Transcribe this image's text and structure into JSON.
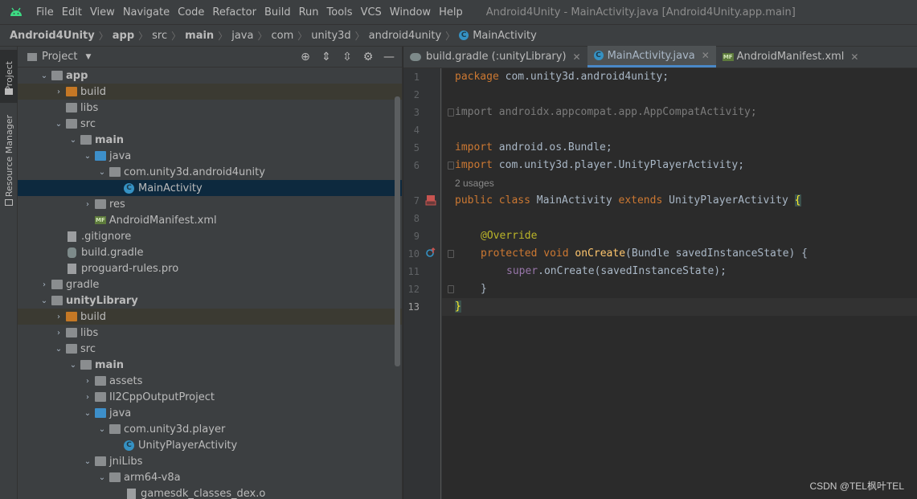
{
  "menubar": {
    "items": [
      "File",
      "Edit",
      "View",
      "Navigate",
      "Code",
      "Refactor",
      "Build",
      "Run",
      "Tools",
      "VCS",
      "Window",
      "Help"
    ],
    "title": "Android4Unity - MainActivity.java [Android4Unity.app.main]"
  },
  "breadcrumb": {
    "items": [
      "Android4Unity",
      "app",
      "src",
      "main",
      "java",
      "com",
      "unity3d",
      "android4unity",
      "MainActivity"
    ]
  },
  "toolstrip": {
    "project_tab": "Project",
    "resource_tab": "Resource Manager"
  },
  "project_panel": {
    "title": "Project",
    "tree": [
      {
        "label": "app",
        "bold": true
      },
      {
        "label": "build"
      },
      {
        "label": "libs"
      },
      {
        "label": "src"
      },
      {
        "label": "main",
        "bold": true
      },
      {
        "label": "java"
      },
      {
        "label": "com.unity3d.android4unity"
      },
      {
        "label": "MainActivity"
      },
      {
        "label": "res"
      },
      {
        "label": "AndroidManifest.xml"
      },
      {
        "label": ".gitignore"
      },
      {
        "label": "build.gradle"
      },
      {
        "label": "proguard-rules.pro"
      },
      {
        "label": "gradle"
      },
      {
        "label": "unityLibrary",
        "bold": true
      },
      {
        "label": "build"
      },
      {
        "label": "libs"
      },
      {
        "label": "src"
      },
      {
        "label": "main",
        "bold": true
      },
      {
        "label": "assets"
      },
      {
        "label": "Il2CppOutputProject"
      },
      {
        "label": "java"
      },
      {
        "label": "com.unity3d.player"
      },
      {
        "label": "UnityPlayerActivity"
      },
      {
        "label": "jniLibs"
      },
      {
        "label": "arm64-v8a"
      },
      {
        "label": "gamesdk_classes_dex.o"
      }
    ]
  },
  "editor": {
    "tabs": [
      {
        "label": "build.gradle (:unityLibrary)"
      },
      {
        "label": "MainActivity.java"
      },
      {
        "label": "AndroidManifest.xml"
      }
    ],
    "line_numbers": [
      "1",
      "2",
      "3",
      "4",
      "5",
      "6",
      "7",
      "8",
      "9",
      "10",
      "11",
      "12",
      "13"
    ],
    "code": {
      "l1_kw": "package",
      "l1_rest": " com.unity3d.android4unity;",
      "l3": "import androidx.appcompat.app.AppCompatActivity;",
      "l5_kw": "import",
      "l5_rest": " android.os.Bundle;",
      "l6_kw": "import",
      "l6_rest": " com.unity3d.player.UnityPlayerActivity;",
      "usages": "2 usages",
      "l7_kw1": "public class",
      "l7_name": " MainActivity ",
      "l7_kw2": "extends",
      "l7_rest": " UnityPlayerActivity ",
      "l7_brace": "{",
      "l9": "@Override",
      "l10_kw": "protected void",
      "l10_fn": "onCreate",
      "l10_rest": "(Bundle savedInstanceState) {",
      "l11_sup": "super",
      "l11_rest": ".onCreate(savedInstanceState);",
      "l12": "}",
      "l13": "}"
    }
  },
  "watermark": "CSDN @TEL枫叶TEL"
}
